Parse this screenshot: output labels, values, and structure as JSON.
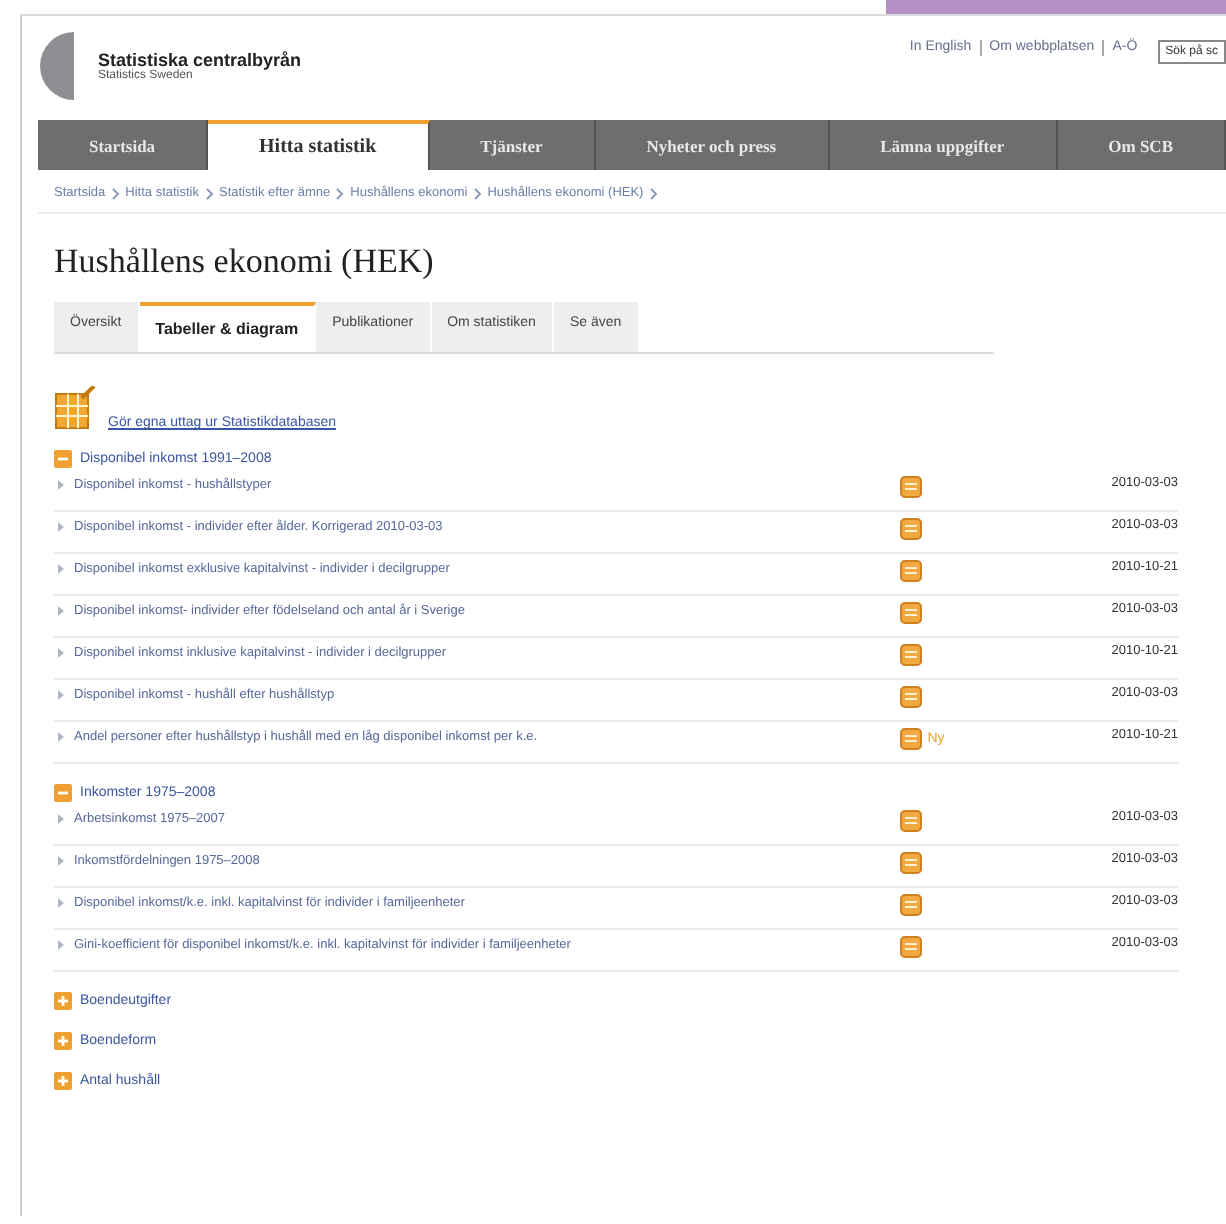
{
  "header": {
    "logo_name": "Statistiska centralbyrån",
    "logo_tagline": "Statistics Sweden",
    "top_links": [
      "In English",
      "Om webbplatsen",
      "A-Ö"
    ],
    "search": {
      "value": "Sök på sc"
    }
  },
  "nav": [
    {
      "label": "Startsida",
      "selected": false
    },
    {
      "label": "Hitta statistik",
      "selected": true
    },
    {
      "label": "Tjänster",
      "selected": false
    },
    {
      "label": "Nyheter och press",
      "selected": false
    },
    {
      "label": "Lämna uppgifter",
      "selected": false
    },
    {
      "label": "Om SCB",
      "selected": false
    }
  ],
  "breadcrumb": [
    "Startsida",
    "Hitta statistik",
    "Statistik efter ämne",
    "Hushållens ekonomi",
    "Hushållens ekonomi (HEK)"
  ],
  "title": "Hushållens ekonomi (HEK)",
  "tabs": [
    {
      "label": "Översikt",
      "selected": false
    },
    {
      "label": "Tabeller & diagram",
      "selected": true
    },
    {
      "label": "Publikationer",
      "selected": false
    },
    {
      "label": "Om statistiken",
      "selected": false
    },
    {
      "label": "Se även",
      "selected": false
    }
  ],
  "database_link": "Gör egna uttag ur Statistikdatabasen",
  "groups": [
    {
      "title": "Disponibel inkomst 1991–2008",
      "expanded": true,
      "rows": [
        {
          "title": "Disponibel inkomst - hushållstyper",
          "date": "2010-03-03"
        },
        {
          "title": "Disponibel inkomst - individer efter ålder. Korrigerad 2010-03-03",
          "date": "2010-03-03"
        },
        {
          "title": "Disponibel inkomst exklusive kapitalvinst - individer i decilgrupper",
          "date": "2010-10-21"
        },
        {
          "title": "Disponibel inkomst- individer efter födelseland och antal år i Sverige",
          "date": "2010-03-03"
        },
        {
          "title": "Disponibel inkomst inklusive kapitalvinst - individer i decilgrupper",
          "date": "2010-10-21"
        },
        {
          "title": "Disponibel inkomst - hushåll efter hushållstyp",
          "date": "2010-03-03"
        },
        {
          "title": "Andel personer efter hushållstyp i hushåll med en låg disponibel inkomst per k.e.",
          "new_badge": "Ny",
          "date": "2010-10-21"
        }
      ]
    },
    {
      "title": "Inkomster 1975–2008",
      "expanded": true,
      "rows": [
        {
          "title": "Arbetsinkomst 1975–2007",
          "date": "2010-03-03"
        },
        {
          "title": "Inkomstfördelningen 1975–2008",
          "date": "2010-03-03"
        },
        {
          "title": "Disponibel inkomst/k.e. inkl. kapitalvinst för individer i familjeenheter",
          "date": "2010-03-03"
        },
        {
          "title": "Gini-koefficient för disponibel inkomst/k.e. inkl. kapitalvinst för individer i familjeenheter",
          "date": "2010-03-03"
        }
      ]
    },
    {
      "title": "Boendeutgifter",
      "expanded": false
    },
    {
      "title": "Boendeform",
      "expanded": false
    },
    {
      "title": "Antal hushåll",
      "expanded": false
    }
  ]
}
